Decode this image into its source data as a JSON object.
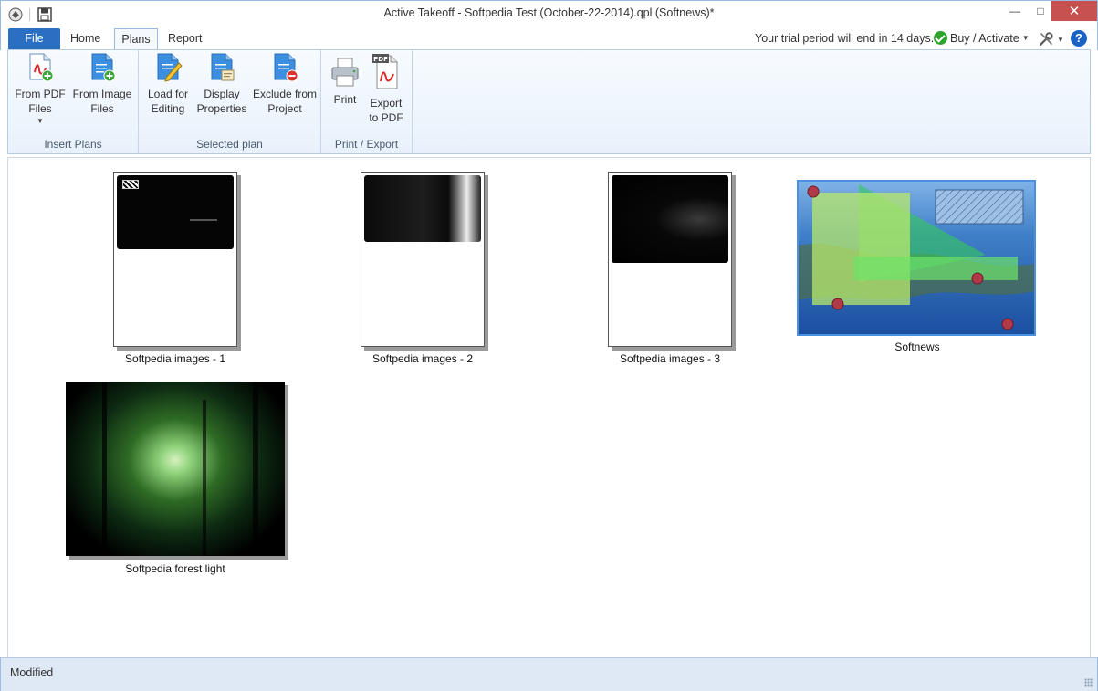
{
  "window": {
    "title": "Active Takeoff - Softpedia Test (October-22-2014).qpl (Softnews)*",
    "min_glyph": "—",
    "max_glyph": "□",
    "close_glyph": "✕"
  },
  "tabs": {
    "file": "File",
    "home": "Home",
    "plans": "Plans",
    "report": "Report",
    "active": "Plans"
  },
  "header": {
    "trial_text": "Your trial period will end in 14 days.",
    "buy_label": "Buy / Activate",
    "help_glyph": "?"
  },
  "ribbon": {
    "groups": [
      {
        "label": "Insert Plans",
        "buttons": [
          {
            "line1": "From PDF",
            "line2": "Files",
            "has_dropdown": true,
            "icon": "pdf-add-icon"
          },
          {
            "line1": "From Image",
            "line2": "Files",
            "icon": "image-add-icon"
          }
        ]
      },
      {
        "label": "Selected plan",
        "buttons": [
          {
            "line1": "Load for",
            "line2": "Editing",
            "icon": "edit-plan-icon"
          },
          {
            "line1": "Display",
            "line2": "Properties",
            "icon": "properties-icon"
          },
          {
            "line1": "Exclude from",
            "line2": "Project",
            "icon": "exclude-icon"
          }
        ]
      },
      {
        "label": "Print / Export",
        "buttons": [
          {
            "line1": "Print",
            "line2": "",
            "icon": "printer-icon"
          },
          {
            "line1": "Export",
            "line2": "to PDF",
            "icon": "pdf-export-icon",
            "badge": "PDF"
          }
        ]
      }
    ]
  },
  "plans": [
    {
      "caption": "Softpedia images - 1",
      "selected": false
    },
    {
      "caption": "Softpedia images - 2",
      "selected": false
    },
    {
      "caption": "Softpedia images - 3",
      "selected": false
    },
    {
      "caption": "Softnews",
      "selected": true
    },
    {
      "caption": "Softpedia forest light",
      "selected": false
    }
  ],
  "status": {
    "text": "Modified"
  },
  "colors": {
    "file_tab": "#2b6fc3",
    "selection": "#4a90e2",
    "close_button": "#c75050",
    "annotation_green": "#7fe26a"
  }
}
